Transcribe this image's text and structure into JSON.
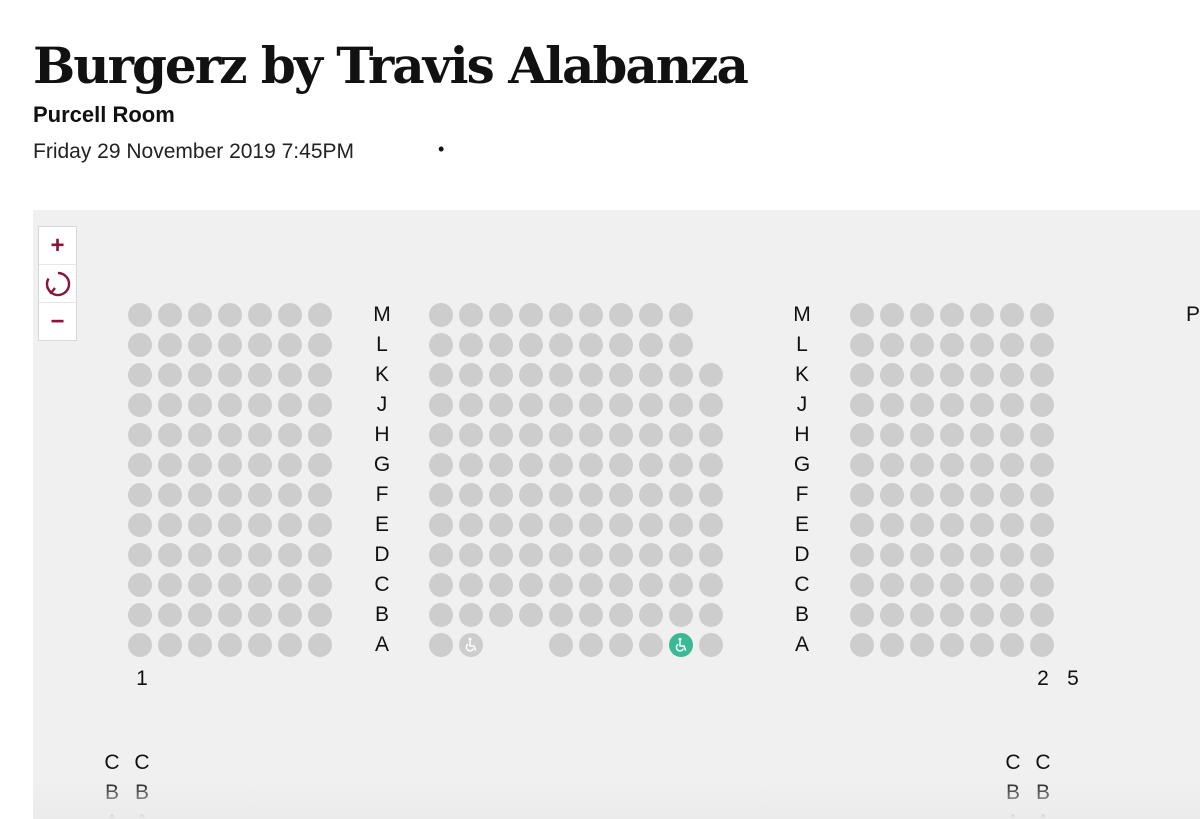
{
  "event": {
    "title": "Burgerz by Travis Alabanza",
    "venue": "Purcell Room",
    "datetime": "Friday 29 November 2019 7:45PM",
    "separator": "•"
  },
  "zoom_controls": {
    "zoom_in": "+",
    "reset_icon": "refresh-icon",
    "zoom_out": "−"
  },
  "seat_map": {
    "rows": [
      "M",
      "L",
      "K",
      "J",
      "H",
      "G",
      "F",
      "E",
      "D",
      "C",
      "B",
      "A"
    ],
    "blocks": [
      {
        "name": "left",
        "seats_per_row": 7
      },
      {
        "name": "center",
        "seats_per_row": 10,
        "top_rows_seats": 9,
        "top_rows": [
          "M",
          "L"
        ]
      },
      {
        "name": "right",
        "seats_per_row": 7
      }
    ],
    "row_A_center": [
      "seat",
      "wheelchair",
      "gap",
      "gap",
      "seat",
      "seat",
      "seat",
      "seat",
      "wheelchair-available",
      "seat"
    ],
    "seat_numbers": [
      "1",
      "2",
      "5"
    ],
    "edge_label": "P",
    "lower_labels_left": [
      [
        "C",
        "C"
      ],
      [
        "B",
        "B"
      ],
      [
        "A",
        "A"
      ]
    ],
    "lower_labels_right": [
      [
        "C",
        "C"
      ],
      [
        "B",
        "B"
      ],
      [
        "A",
        "A"
      ]
    ],
    "colors": {
      "seat_unavailable": "#cdcdcd",
      "seat_wheelchair_available": "#3ab993",
      "accent": "#8a1538",
      "background": "#f0f0f0"
    }
  }
}
